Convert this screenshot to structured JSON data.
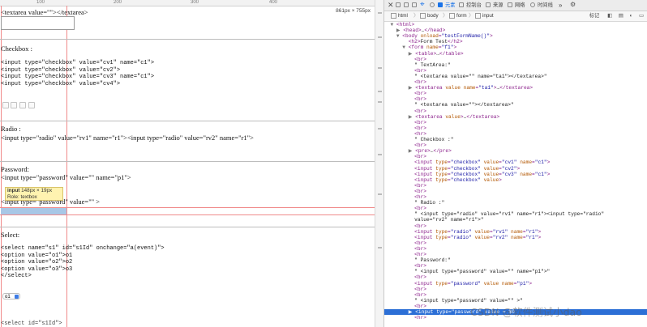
{
  "ruler": {
    "ticks": [
      "100",
      "200",
      "300",
      "400"
    ]
  },
  "page": {
    "size_label": "861px × 755px",
    "textarea_code": "<textarea value=\"\"></textarea>",
    "checkbox_heading": "Checkbox :",
    "checkbox_code": [
      "<input type=\"checkbox\" value=\"cv1\" name=\"c1\">",
      "<input type=\"checkbox\" value=\"cv2\">",
      "<input type=\"checkbox\" value=\"cv3\" name=\"c1\">",
      "<input type=\"checkbox\" value=\"cv4\">"
    ],
    "radio_heading": "Radio :",
    "radio_code": "<input type=\"radio\" value=\"rv1\" name=\"r1\"><input type=\"radio\" value=\"rv2\" name=\"r1\">",
    "password_heading": "Password:",
    "password_code_1": "<input type=\"password\" value=\"\" name=\"p1\">",
    "password_code_2": "<input type=\"password\" value=\"\" >",
    "tooltip": {
      "label": "input",
      "size": "148px × 19px",
      "role": "Role: textbox"
    },
    "select_heading": "Select:",
    "select_code": [
      "<select name=\"s1\" id=\"s1Id\" onchange=\"a(event)\">",
      "<option value=\"o1\">o1",
      "<option value=\"o2\">o2",
      "<option value=\"o3\">o3",
      "</select>"
    ],
    "select_value": "o1",
    "bottom_code": "<select id=\"s1Id\">"
  },
  "devtools": {
    "tabs": [
      "元素",
      "控制台",
      "来源",
      "网络",
      "时间线"
    ],
    "more": "»",
    "breadcrumb": [
      "html",
      "body",
      "form",
      "input"
    ],
    "right_label": "标记",
    "tree": [
      {
        "indent": 0,
        "tri": "▼",
        "parts": [
          [
            "tg",
            "<html>"
          ]
        ],
        "sel": false
      },
      {
        "indent": 1,
        "tri": "▶",
        "parts": [
          [
            "tg",
            "<head>"
          ],
          [
            "tx",
            "…"
          ],
          [
            "tg",
            "</head>"
          ]
        ],
        "sel": false
      },
      {
        "indent": 1,
        "tri": "▼",
        "parts": [
          [
            "tg",
            "<body "
          ],
          [
            "at",
            "onload"
          ],
          [
            "tg",
            "="
          ],
          [
            "av",
            "\"testFormName()\""
          ],
          [
            "tg",
            ">"
          ]
        ],
        "sel": false
      },
      {
        "indent": 2,
        "tri": " ",
        "parts": [
          [
            "tg",
            "<h2>"
          ],
          [
            "tx",
            "Form Test"
          ],
          [
            "tg",
            "</h2>"
          ]
        ],
        "sel": false
      },
      {
        "indent": 2,
        "tri": "▼",
        "parts": [
          [
            "tg",
            "<form "
          ],
          [
            "at",
            "name"
          ],
          [
            "tg",
            "="
          ],
          [
            "av",
            "\"f1\""
          ],
          [
            "tg",
            ">"
          ]
        ],
        "sel": false
      },
      {
        "indent": 3,
        "tri": "▶",
        "parts": [
          [
            "tg",
            "<table>"
          ],
          [
            "tx",
            "…"
          ],
          [
            "tg",
            "</table>"
          ]
        ],
        "sel": false
      },
      {
        "indent": 3,
        "tri": " ",
        "parts": [
          [
            "tg",
            "<br>"
          ]
        ],
        "sel": false
      },
      {
        "indent": 3,
        "tri": " ",
        "parts": [
          [
            "tx",
            "\" TextArea:\""
          ]
        ],
        "sel": false
      },
      {
        "indent": 3,
        "tri": " ",
        "parts": [
          [
            "tg",
            "<br>"
          ]
        ],
        "sel": false
      },
      {
        "indent": 3,
        "tri": " ",
        "parts": [
          [
            "tx",
            "\" <textarea value=\"\" name=\"ta1\"></textarea>\""
          ]
        ],
        "sel": false
      },
      {
        "indent": 3,
        "tri": " ",
        "parts": [
          [
            "tg",
            "<br>"
          ]
        ],
        "sel": false
      },
      {
        "indent": 3,
        "tri": "▶",
        "parts": [
          [
            "tg",
            "<textarea "
          ],
          [
            "at",
            "value"
          ],
          [
            "tg",
            " "
          ],
          [
            "at",
            "name"
          ],
          [
            "tg",
            "="
          ],
          [
            "av",
            "\"ta1\""
          ],
          [
            "tg",
            ">"
          ],
          [
            "tx",
            "…"
          ],
          [
            "tg",
            "</textarea>"
          ]
        ],
        "sel": false
      },
      {
        "indent": 3,
        "tri": " ",
        "parts": [
          [
            "tg",
            "<br>"
          ]
        ],
        "sel": false
      },
      {
        "indent": 3,
        "tri": " ",
        "parts": [
          [
            "tg",
            "<br>"
          ]
        ],
        "sel": false
      },
      {
        "indent": 3,
        "tri": " ",
        "parts": [
          [
            "tx",
            "\" <textarea value=\"\"></textarea>\""
          ]
        ],
        "sel": false
      },
      {
        "indent": 3,
        "tri": " ",
        "parts": [
          [
            "tg",
            "<br>"
          ]
        ],
        "sel": false
      },
      {
        "indent": 3,
        "tri": "▶",
        "parts": [
          [
            "tg",
            "<textarea "
          ],
          [
            "at",
            "value"
          ],
          [
            "tg",
            ">"
          ],
          [
            "tx",
            "…"
          ],
          [
            "tg",
            "</textarea>"
          ]
        ],
        "sel": false
      },
      {
        "indent": 3,
        "tri": " ",
        "parts": [
          [
            "tg",
            "<br>"
          ]
        ],
        "sel": false
      },
      {
        "indent": 3,
        "tri": " ",
        "parts": [
          [
            "tg",
            "<br>"
          ]
        ],
        "sel": false
      },
      {
        "indent": 3,
        "tri": " ",
        "parts": [
          [
            "tg",
            "<hr>"
          ]
        ],
        "sel": false
      },
      {
        "indent": 3,
        "tri": " ",
        "parts": [
          [
            "tx",
            "\" Checkbox :\""
          ]
        ],
        "sel": false
      },
      {
        "indent": 3,
        "tri": " ",
        "parts": [
          [
            "tg",
            "<br>"
          ]
        ],
        "sel": false
      },
      {
        "indent": 3,
        "tri": "▶",
        "parts": [
          [
            "tg",
            "<pre>"
          ],
          [
            "tx",
            "…"
          ],
          [
            "tg",
            "</pre>"
          ]
        ],
        "sel": false
      },
      {
        "indent": 3,
        "tri": " ",
        "parts": [
          [
            "tg",
            "<br>"
          ]
        ],
        "sel": false
      },
      {
        "indent": 3,
        "tri": " ",
        "parts": [
          [
            "tg",
            "<input "
          ],
          [
            "at",
            "type"
          ],
          [
            "tg",
            "="
          ],
          [
            "av",
            "\"checkbox\""
          ],
          [
            "tg",
            " "
          ],
          [
            "at",
            "value"
          ],
          [
            "tg",
            "="
          ],
          [
            "av",
            "\"cv1\""
          ],
          [
            "tg",
            " "
          ],
          [
            "at",
            "name"
          ],
          [
            "tg",
            "="
          ],
          [
            "av",
            "\"c1\""
          ],
          [
            "tg",
            ">"
          ]
        ],
        "sel": false
      },
      {
        "indent": 3,
        "tri": " ",
        "parts": [
          [
            "tg",
            "<input "
          ],
          [
            "at",
            "type"
          ],
          [
            "tg",
            "="
          ],
          [
            "av",
            "\"checkbox\""
          ],
          [
            "tg",
            " "
          ],
          [
            "at",
            "value"
          ],
          [
            "tg",
            "="
          ],
          [
            "av",
            "\"cv2\""
          ],
          [
            "tg",
            ">"
          ]
        ],
        "sel": false
      },
      {
        "indent": 3,
        "tri": " ",
        "parts": [
          [
            "tg",
            "<input "
          ],
          [
            "at",
            "type"
          ],
          [
            "tg",
            "="
          ],
          [
            "av",
            "\"checkbox\""
          ],
          [
            "tg",
            " "
          ],
          [
            "at",
            "value"
          ],
          [
            "tg",
            "="
          ],
          [
            "av",
            "\"cv3\""
          ],
          [
            "tg",
            " "
          ],
          [
            "at",
            "name"
          ],
          [
            "tg",
            "="
          ],
          [
            "av",
            "\"c1\""
          ],
          [
            "tg",
            ">"
          ]
        ],
        "sel": false
      },
      {
        "indent": 3,
        "tri": " ",
        "parts": [
          [
            "tg",
            "<input "
          ],
          [
            "at",
            "type"
          ],
          [
            "tg",
            "="
          ],
          [
            "av",
            "\"checkbox\""
          ],
          [
            "tg",
            " "
          ],
          [
            "at",
            "value"
          ],
          [
            "tg",
            ">"
          ]
        ],
        "sel": false
      },
      {
        "indent": 3,
        "tri": " ",
        "parts": [
          [
            "tg",
            "<br>"
          ]
        ],
        "sel": false
      },
      {
        "indent": 3,
        "tri": " ",
        "parts": [
          [
            "tg",
            "<br>"
          ]
        ],
        "sel": false
      },
      {
        "indent": 3,
        "tri": " ",
        "parts": [
          [
            "tg",
            "<hr>"
          ]
        ],
        "sel": false
      },
      {
        "indent": 3,
        "tri": " ",
        "parts": [
          [
            "tx",
            "\" Radio :\""
          ]
        ],
        "sel": false
      },
      {
        "indent": 3,
        "tri": " ",
        "parts": [
          [
            "tg",
            "<br>"
          ]
        ],
        "sel": false
      },
      {
        "indent": 3,
        "tri": " ",
        "parts": [
          [
            "tx",
            "\" <input type=\"radio\" value=\"rv1\" name=\"r1\"><input type=\"radio\""
          ]
        ],
        "sel": false
      },
      {
        "indent": 3,
        "tri": " ",
        "parts": [
          [
            "tx",
            "value=\"rv2\" name=\"r1\">\""
          ]
        ],
        "sel": false
      },
      {
        "indent": 3,
        "tri": " ",
        "parts": [
          [
            "tg",
            "<br>"
          ]
        ],
        "sel": false
      },
      {
        "indent": 3,
        "tri": " ",
        "parts": [
          [
            "tg",
            "<input "
          ],
          [
            "at",
            "type"
          ],
          [
            "tg",
            "="
          ],
          [
            "av",
            "\"radio\""
          ],
          [
            "tg",
            " "
          ],
          [
            "at",
            "value"
          ],
          [
            "tg",
            "="
          ],
          [
            "av",
            "\"rv1\""
          ],
          [
            "tg",
            " "
          ],
          [
            "at",
            "name"
          ],
          [
            "tg",
            "="
          ],
          [
            "av",
            "\"r1\""
          ],
          [
            "tg",
            ">"
          ]
        ],
        "sel": false
      },
      {
        "indent": 3,
        "tri": " ",
        "parts": [
          [
            "tg",
            "<input "
          ],
          [
            "at",
            "type"
          ],
          [
            "tg",
            "="
          ],
          [
            "av",
            "\"radio\""
          ],
          [
            "tg",
            " "
          ],
          [
            "at",
            "value"
          ],
          [
            "tg",
            "="
          ],
          [
            "av",
            "\"rv2\""
          ],
          [
            "tg",
            " "
          ],
          [
            "at",
            "name"
          ],
          [
            "tg",
            "="
          ],
          [
            "av",
            "\"r1\""
          ],
          [
            "tg",
            ">"
          ]
        ],
        "sel": false
      },
      {
        "indent": 3,
        "tri": " ",
        "parts": [
          [
            "tg",
            "<br>"
          ]
        ],
        "sel": false
      },
      {
        "indent": 3,
        "tri": " ",
        "parts": [
          [
            "tg",
            "<br>"
          ]
        ],
        "sel": false
      },
      {
        "indent": 3,
        "tri": " ",
        "parts": [
          [
            "tg",
            "<hr>"
          ]
        ],
        "sel": false
      },
      {
        "indent": 3,
        "tri": " ",
        "parts": [
          [
            "tx",
            "\" Password:\""
          ]
        ],
        "sel": false
      },
      {
        "indent": 3,
        "tri": " ",
        "parts": [
          [
            "tg",
            "<br>"
          ]
        ],
        "sel": false
      },
      {
        "indent": 3,
        "tri": " ",
        "parts": [
          [
            "tx",
            "\" <input type=\"password\" value=\"\" name=\"p1\">\""
          ]
        ],
        "sel": false
      },
      {
        "indent": 3,
        "tri": " ",
        "parts": [
          [
            "tg",
            "<br>"
          ]
        ],
        "sel": false
      },
      {
        "indent": 3,
        "tri": " ",
        "parts": [
          [
            "tg",
            "<input "
          ],
          [
            "at",
            "type"
          ],
          [
            "tg",
            "="
          ],
          [
            "av",
            "\"password\""
          ],
          [
            "tg",
            " "
          ],
          [
            "at",
            "value"
          ],
          [
            "tg",
            " "
          ],
          [
            "at",
            "name"
          ],
          [
            "tg",
            "="
          ],
          [
            "av",
            "\"p1\""
          ],
          [
            "tg",
            ">"
          ]
        ],
        "sel": false
      },
      {
        "indent": 3,
        "tri": " ",
        "parts": [
          [
            "tg",
            "<br>"
          ]
        ],
        "sel": false
      },
      {
        "indent": 3,
        "tri": " ",
        "parts": [
          [
            "tg",
            "<br>"
          ]
        ],
        "sel": false
      },
      {
        "indent": 3,
        "tri": " ",
        "parts": [
          [
            "tx",
            "\" <input type=\"password\" value=\"\" >\""
          ]
        ],
        "sel": false
      },
      {
        "indent": 3,
        "tri": " ",
        "parts": [
          [
            "tg",
            "<br>"
          ]
        ],
        "sel": false
      },
      {
        "indent": 3,
        "tri": "▶",
        "parts": [
          [
            "tg",
            "<input "
          ],
          [
            "at",
            "type"
          ],
          [
            "tg",
            "="
          ],
          [
            "av",
            "\"password\""
          ],
          [
            "tg",
            " "
          ],
          [
            "at",
            "value"
          ],
          [
            "tg",
            " = $0"
          ]
        ],
        "sel": true
      },
      {
        "indent": 3,
        "tri": " ",
        "parts": [
          [
            "tg",
            "<hr>"
          ]
        ],
        "sel": false
      }
    ]
  },
  "watermark": "CSDN @软件测试小dao"
}
